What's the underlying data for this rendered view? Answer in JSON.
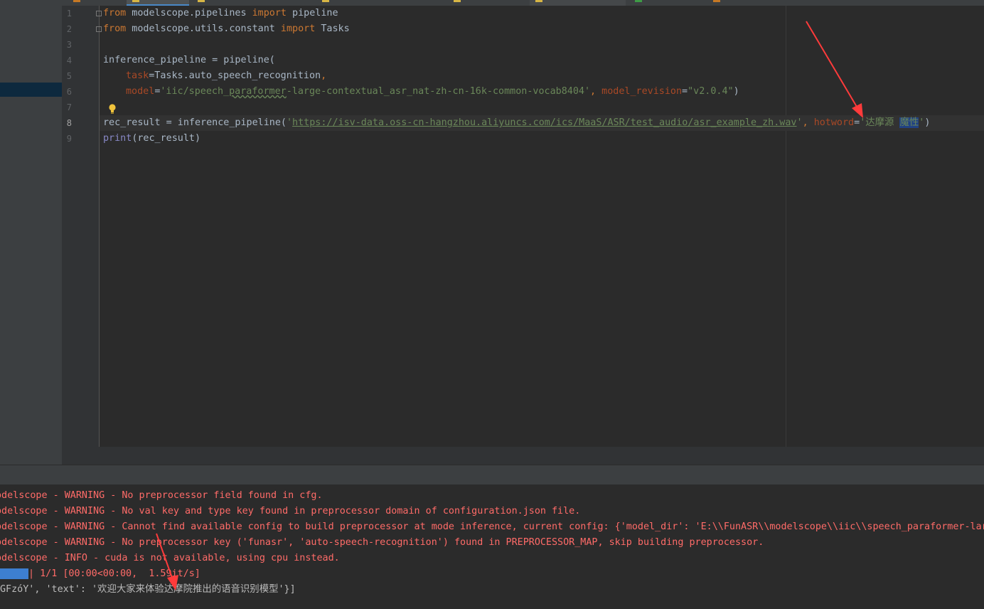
{
  "editor": {
    "line_numbers": [
      "1",
      "2",
      "3",
      "4",
      "5",
      "6",
      "7",
      "8",
      "9"
    ],
    "line1": {
      "kw_from": "from",
      "module": " modelscope.pipelines ",
      "kw_import": "import",
      "name": " pipeline"
    },
    "line2": {
      "kw_from": "from",
      "module": " modelscope.utils.constant ",
      "kw_import": "import",
      "name": " Tasks"
    },
    "line4": {
      "text": "inference_pipeline = pipeline("
    },
    "line5": {
      "param": "task",
      "value": "=Tasks.auto_speech_recognition",
      "comma": ","
    },
    "line6": {
      "param": "model",
      "eq": "=",
      "model_str_a": "'iic/speech_",
      "model_str_b": "paraformer",
      "model_str_c": "-large-contextual_asr_nat-zh-cn-16k-common-vocab8404'",
      "sep": ", ",
      "param2": "model_revision",
      "eq2": "=",
      "revision": "\"v2.0.4\"",
      "close": ")"
    },
    "line8": {
      "prefix": "rec_result = inference_pipeline(",
      "quote_open": "'",
      "url": "https://isv-data.oss-cn-hangzhou.aliyuncs.com/ics/MaaS/ASR/test_audio/asr_example_zh.wav",
      "quote_close": "'",
      "sep": ", ",
      "param": "hotword",
      "eq": "=",
      "hw_open": "'达摩源 ",
      "hw_selected": "魔性",
      "hw_close": "'",
      "close": ")"
    },
    "line9": {
      "builtin": "print",
      "args": "(rec_result)"
    }
  },
  "console": {
    "line0": "odelscope - WARNING - No preprocessor field found in cfg.",
    "line1": "odelscope - WARNING - No val key and type key found in preprocessor domain of configuration.json file.",
    "line2": "odelscope - WARNING - Cannot find available config to build preprocessor at mode inference, current config: {'model_dir': 'E:\\\\FunASR\\\\modelscope\\\\iic\\\\speech_paraformer-lar",
    "line3": "odelscope - WARNING - No preprocessor key ('funasr', 'auto-speech-recognition') found in PREPROCESSOR_MAP, skip building preprocessor.",
    "line4": "odelscope - INFO - cuda is not available, using cpu instead.",
    "progress": "| 1/1 [00:00<00:00,  1.59it/s]",
    "result": "GFzóY', 'text': '欢迎大家来体验达摩院推出的语音识别模型'}]"
  },
  "colors": {
    "keyword": "#cc7832",
    "string": "#6a8759",
    "param": "#aa4926",
    "builtin": "#8888c6",
    "warning": "#ff6b68",
    "annotation_arrow": "#ff3b3b"
  },
  "icons": [
    "fold-marker-icon",
    "lightbulb-icon",
    "annotation-arrow-icon"
  ]
}
